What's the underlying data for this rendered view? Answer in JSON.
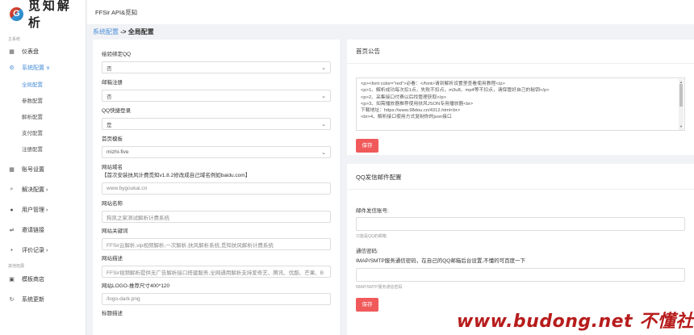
{
  "brand": {
    "logo_letter": "G",
    "name": "觅知解析"
  },
  "topbar": {
    "title": "FFSir API&觅知"
  },
  "sidebar": {
    "group_main": "主系统",
    "group_other": "其他拓展",
    "items": [
      {
        "label": "仪表盘",
        "icon": "dashboard-icon"
      },
      {
        "label": "系统配置 ∨",
        "icon": "gear-icon"
      },
      {
        "label": "账号设置",
        "icon": "grid-icon"
      },
      {
        "label": "解决配置 ›",
        "icon": "search-icon"
      },
      {
        "label": "用户管理 ›",
        "icon": "user-icon"
      },
      {
        "label": "邀请链接",
        "icon": "link-icon"
      },
      {
        "label": "评价记录 ›",
        "icon": "dot-icon"
      },
      {
        "label": "模板商店",
        "icon": "shop-icon"
      },
      {
        "label": "系统更新",
        "icon": "refresh-icon"
      }
    ],
    "sub_items": [
      "全局配置",
      "参数配置",
      "解析配置",
      "支付配置",
      "注册配置"
    ]
  },
  "breadcrumb": {
    "link": "系统配置",
    "sep": " -> ",
    "current": "全局配置"
  },
  "form": {
    "f1": {
      "label": "绘验绑定QQ",
      "value": "否"
    },
    "f2": {
      "label": "邮箱注册",
      "value": "否"
    },
    "f3": {
      "label": "QQ快捷登录",
      "value": "是"
    },
    "f4": {
      "label": "首页模板",
      "value": "mizhi-five"
    },
    "f5": {
      "label": "网站域名",
      "note": "【首次安装扶风计费觅知v1.8.2修改成自己域名例如baidu.com】",
      "value": "www.bygoukai.cn"
    },
    "f6": {
      "label": "网站名称",
      "value": "狗凯之家测试解析计费系统"
    },
    "f7": {
      "label": "网站关键词",
      "value": "FFSir云解析,vip视频解析,一次解析,扶风解析系统,觅知扶风解析计费系统"
    },
    "f8": {
      "label": "网站描述",
      "value": "FFSir视频解析提供无广告解析接口搭建服务,全网通用解析支持爱奇艺、腾讯、优酷、芒果、B"
    },
    "f9": {
      "label": "网站LOGO-推荐尺寸400*120",
      "value": "/logo-dark.png"
    },
    "f10": {
      "label": "标题描述"
    }
  },
  "notice": {
    "title": "首页公告",
    "lines": [
      "<p><font color=\"red\">必看：</font>请到解析设置里查看使用教程</p>",
      "<p>1、解析成功每次扣1点，失败不扣点，m3u8、mp4等不扣点，请保管好自己的秘钥</p>",
      "<p>2、采集接口付费以后找管理获取</p>",
      "<p>3、如需播放器推荐使用扶风JSON专用播放器<br>",
      "下载地址：https://www.98dou.cn/4312.html<br>",
      "<br>4、解析接口使用方式复制你的json接口"
    ],
    "save": "保存"
  },
  "mail": {
    "title": "QQ发信邮件配置",
    "account_label": "邮件发信账号:",
    "account_hint": "只能是QQ的邮箱",
    "pwd_label": "通信密码:",
    "pwd_desc": "IMAP/SMTP服务通信密码，在自己的QQ邮箱后台设置,不懂的可百度一下",
    "pwd_hint": "IMAP/SMTP服务通信密码",
    "save": "保存"
  },
  "watermark": "www.budong.net 不懂社区"
}
